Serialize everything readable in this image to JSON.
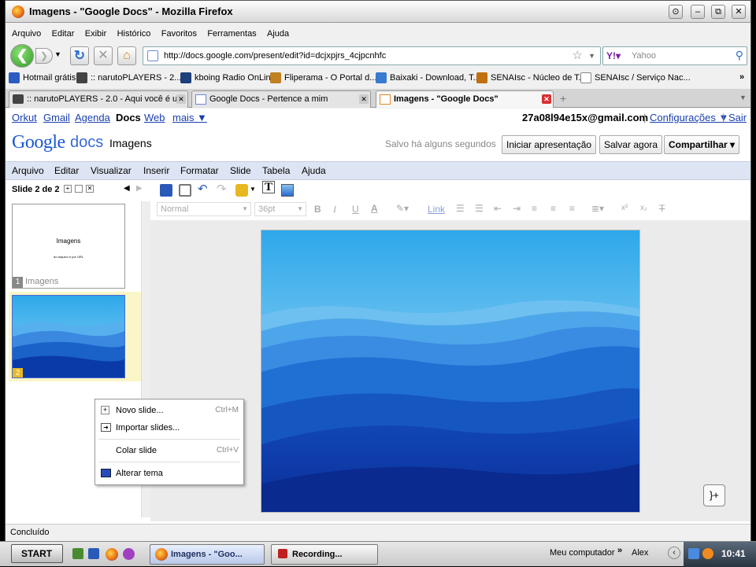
{
  "window": {
    "title": "Imagens - \"Google Docs\" - Mozilla Firefox",
    "menu": [
      "Arquivo",
      "Editar",
      "Exibir",
      "Histórico",
      "Favoritos",
      "Ferramentas",
      "Ajuda"
    ]
  },
  "nav": {
    "url": "http://docs.google.com/present/edit?id=dcjxpjrs_4cjpcnhfc",
    "search_placeholder": "Yahoo"
  },
  "bookmarks": [
    {
      "label": "Hotmail grátis",
      "color": "#2b5cc2"
    },
    {
      "label": ":: narutoPLAYERS - 2....",
      "color": "#444444"
    },
    {
      "label": "kboing Radio OnLine",
      "color": "#1d3f7a"
    },
    {
      "label": "Fliperama - O Portal d...",
      "color": "#c08020"
    },
    {
      "label": "Baixaki - Download, T...",
      "color": "#3a7ad0"
    },
    {
      "label": "SENAIsc - Núcleo de T...",
      "color": "#c07010"
    },
    {
      "label": "SENAIsc / Serviço Nac...",
      "color": "#888888"
    }
  ],
  "tabs": [
    {
      "label": ":: narutoPLAYERS - 2.0 - Aqui você é u..."
    },
    {
      "label": "Google Docs - Pertence a mim"
    },
    {
      "label": "Imagens - \"Google Docs\""
    }
  ],
  "gbar": {
    "links": [
      "Orkut",
      "Gmail",
      "Agenda",
      "Docs",
      "Web",
      "mais ▼"
    ],
    "user": "27a08l94e15x@gmail.com",
    "settings": "Configurações ▼",
    "separator": "|",
    "signout": "Sair"
  },
  "doc": {
    "logo_google": "Google",
    "logo_docs": "docs",
    "name": "Imagens",
    "save_status": "Salvo há alguns segundos",
    "start_presentation": "Iniciar apresentação",
    "save_now": "Salvar agora",
    "share": "Compartilhar ▾"
  },
  "app_menu": [
    "Arquivo",
    "Editar",
    "Visualizar",
    "Inserir",
    "Formatar",
    "Slide",
    "Tabela",
    "Ajuda"
  ],
  "slides_panel": {
    "counter": "Slide 2 de 2",
    "slide1": {
      "number": "1",
      "title": "Imagens",
      "subtitle": "do arquivo e por URL",
      "caption": "Imagens"
    },
    "slide2": {
      "number": "2"
    }
  },
  "format_toolbar": {
    "style": "Normal",
    "size": "36pt",
    "bold": "B",
    "italic": "I",
    "underline": "U",
    "text_color": "A",
    "link": "Link",
    "superscript": "x²",
    "subscript": "x₂"
  },
  "context_menu": [
    {
      "label": "Novo slide...",
      "shortcut": "Ctrl+M"
    },
    {
      "label": "Importar slides...",
      "shortcut": ""
    },
    {
      "label": "Colar slide",
      "shortcut": "Ctrl+V"
    },
    {
      "label": "Alterar tema",
      "shortcut": ""
    }
  ],
  "status": "Concluído",
  "taskbar": {
    "start": "START",
    "tasks": [
      "Imagens - \"Goo...",
      "Recording..."
    ],
    "tray_label": "Meu computador",
    "user": "Alex",
    "clock": "10:41"
  },
  "colors": {
    "link": "#1a40b0",
    "menu_bg": "#dde5f4",
    "sky_top": "#2ea8ea",
    "mountain_dark": "#0a3aa8"
  }
}
